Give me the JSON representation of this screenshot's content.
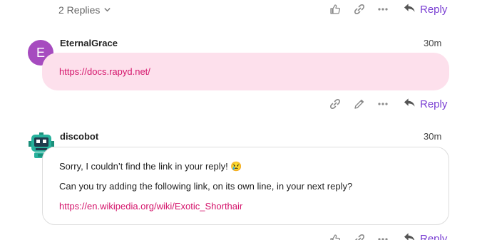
{
  "thread": {
    "replies_label": "2 Replies",
    "reply_label": "Reply"
  },
  "posts": [
    {
      "avatar_letter": "E",
      "avatar_color": "#a64bbf",
      "username": "EternalGrace",
      "time": "30m",
      "link": "https://docs.rapyd.net/",
      "bubble_color": "#fde0ec",
      "reply_label": "Reply"
    },
    {
      "username": "discobot",
      "time": "30m",
      "line1": "Sorry, I couldn’t find the link in your reply!",
      "emoji": "😢",
      "line2": "Can you try adding the following link, on its own line, in your next reply?",
      "link": "https://en.wikipedia.org/wiki/Exotic_Shorthair",
      "reply_label": "Reply"
    }
  ],
  "colors": {
    "accent": "#7a3fd3",
    "link": "#d4146b",
    "icon": "#8a8a8a"
  }
}
